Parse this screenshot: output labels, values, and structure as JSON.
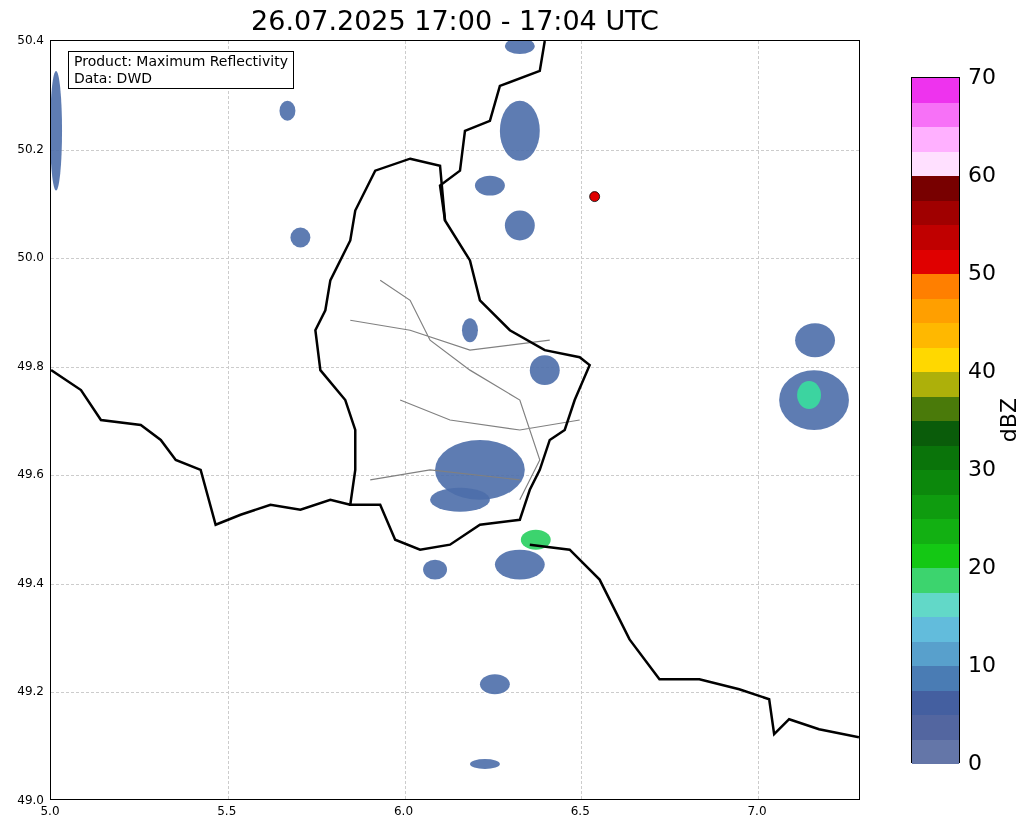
{
  "title": "26.07.2025 17:00 - 17:04 UTC",
  "info_box": [
    "Product: Maximum Reflectivity",
    "Data: DWD"
  ],
  "x_ticks": [
    "5.0",
    "5.5",
    "6.0",
    "6.5",
    "7.0"
  ],
  "y_ticks": [
    "50.4",
    "50.2",
    "50.0",
    "49.8",
    "49.6",
    "49.4",
    "49.2",
    "49.0"
  ],
  "colorbar": {
    "label": "dBZ",
    "ticks": [
      "70",
      "60",
      "50",
      "40",
      "30",
      "20",
      "10",
      "0"
    ],
    "bins": [
      {
        "color": "#ee33ee"
      },
      {
        "color": "#f771f7"
      },
      {
        "color": "#ffb0ff"
      },
      {
        "color": "#ffe0ff"
      },
      {
        "color": "#780000"
      },
      {
        "color": "#a00000"
      },
      {
        "color": "#c00000"
      },
      {
        "color": "#e00000"
      },
      {
        "color": "#ff7f00"
      },
      {
        "color": "#ff9f00"
      },
      {
        "color": "#ffb800"
      },
      {
        "color": "#ffd800"
      },
      {
        "color": "#adb00a"
      },
      {
        "color": "#4a7a0a"
      },
      {
        "color": "#0a5c0a"
      },
      {
        "color": "#0a740a"
      },
      {
        "color": "#0c880c"
      },
      {
        "color": "#0f9c0f"
      },
      {
        "color": "#12b012"
      },
      {
        "color": "#14c814"
      },
      {
        "color": "#3cd46e"
      },
      {
        "color": "#62d8c8"
      },
      {
        "color": "#62bcdc"
      },
      {
        "color": "#58a0cc"
      },
      {
        "color": "#4a7cb4"
      },
      {
        "color": "#445fa0"
      },
      {
        "color": "#5366a0"
      },
      {
        "color": "#6476a8"
      }
    ]
  }
}
